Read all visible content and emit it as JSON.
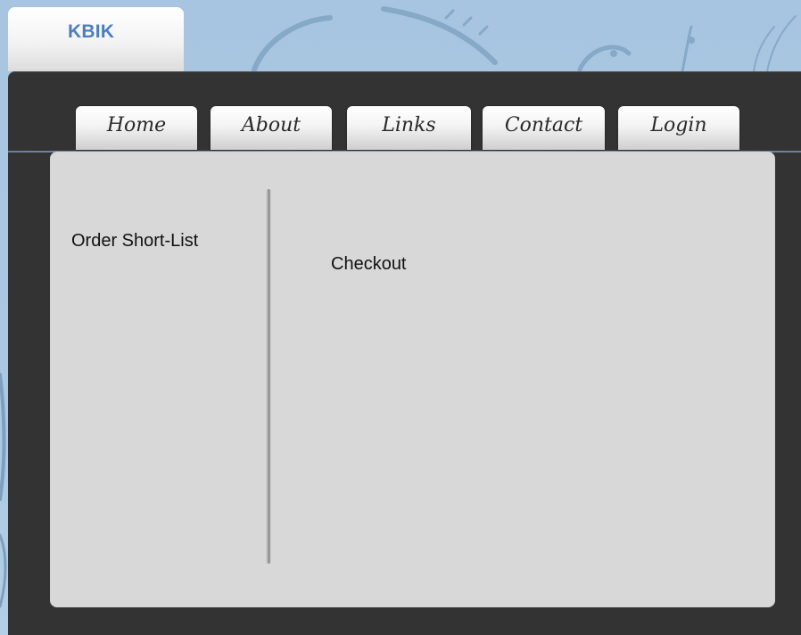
{
  "header": {
    "logo": "KBIK"
  },
  "nav": {
    "items": [
      {
        "label": "Home"
      },
      {
        "label": "About"
      },
      {
        "label": "Links"
      },
      {
        "label": "Contact"
      },
      {
        "label": "Login"
      }
    ]
  },
  "sidebar": {
    "title": "Order Short-List"
  },
  "main": {
    "title": "Checkout"
  },
  "colors": {
    "background_blue": "#a9c6e0",
    "frame_dark": "#333333",
    "panel_gray": "#d8d8d8",
    "logo_blue": "#4c7fbf"
  }
}
